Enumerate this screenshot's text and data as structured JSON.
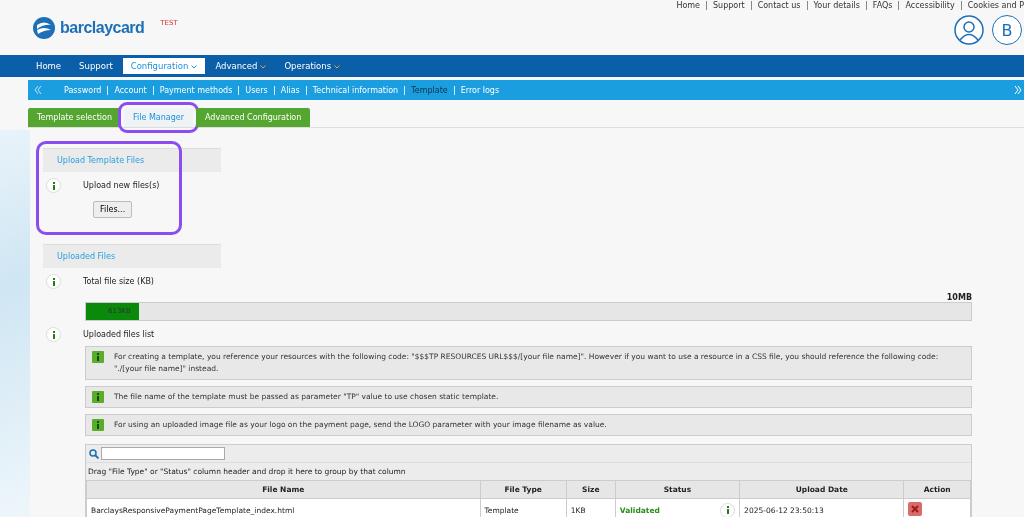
{
  "header": {
    "logo": "barclaycard",
    "env_badge": "TEST",
    "top_links": [
      "Home",
      "Support",
      "Contact us",
      "Your details",
      "FAQs",
      "Accessibility",
      "Cookies and P"
    ],
    "avatar_initial": "B"
  },
  "main_nav": [
    {
      "label": "Home",
      "selected": false,
      "dropdown": false
    },
    {
      "label": "Support",
      "selected": false,
      "dropdown": false
    },
    {
      "label": "Configuration",
      "selected": true,
      "dropdown": true
    },
    {
      "label": "Advanced",
      "selected": false,
      "dropdown": true
    },
    {
      "label": "Operations",
      "selected": false,
      "dropdown": true
    }
  ],
  "sub_nav": [
    {
      "label": "Password",
      "selected": false
    },
    {
      "label": "Account",
      "selected": false
    },
    {
      "label": "Payment methods",
      "selected": false
    },
    {
      "label": "Users",
      "selected": false
    },
    {
      "label": "Alias",
      "selected": false
    },
    {
      "label": "Technical information",
      "selected": false
    },
    {
      "label": "Template",
      "selected": true
    },
    {
      "label": "Error logs",
      "selected": false
    }
  ],
  "tabs": [
    {
      "label": "Template selection",
      "selected": false,
      "highlighted": false
    },
    {
      "label": "File Manager",
      "selected": true,
      "highlighted": true
    },
    {
      "label": "Advanced Configuration",
      "selected": false,
      "highlighted": false
    }
  ],
  "upload_section": {
    "title": "Upload Template Files",
    "highlighted": true,
    "label": "Upload new files(s)",
    "button": "Files..."
  },
  "uploaded_section": {
    "title": "Uploaded Files",
    "size_label": "Total file size (KB)",
    "size_max": "10MB",
    "size_reading": "613KB",
    "level": 0.06,
    "list_label": "Uploaded files list",
    "notes": [
      "For creating a template, you reference your resources with the following code: \"$$$TP RESOURCES URL$$$/[your file name]\". However if you want to use a resource in a CSS file, you should reference the following code: \"./[your file name]\" instead.",
      "The file name of the template must be passed as parameter \"TP\" value to use chosen static template.",
      "For using an uploaded image file as your logo on the payment page, send the LOGO parameter with your image filename as value."
    ]
  },
  "table": {
    "group_hint": "Drag \"File Type\" or \"Status\" column header and drop it here to group by that column",
    "columns": [
      "File Name",
      "File Type",
      "Size",
      "Status",
      "Upload Date",
      "Action"
    ],
    "rows": [
      {
        "file_name": "BarclaysResponsivePaymentPageTemplate_index.html",
        "file_type": "Template",
        "size": "1KB",
        "status": "Validated",
        "upload_date": "2025-06-12 23:50:13"
      }
    ]
  }
}
